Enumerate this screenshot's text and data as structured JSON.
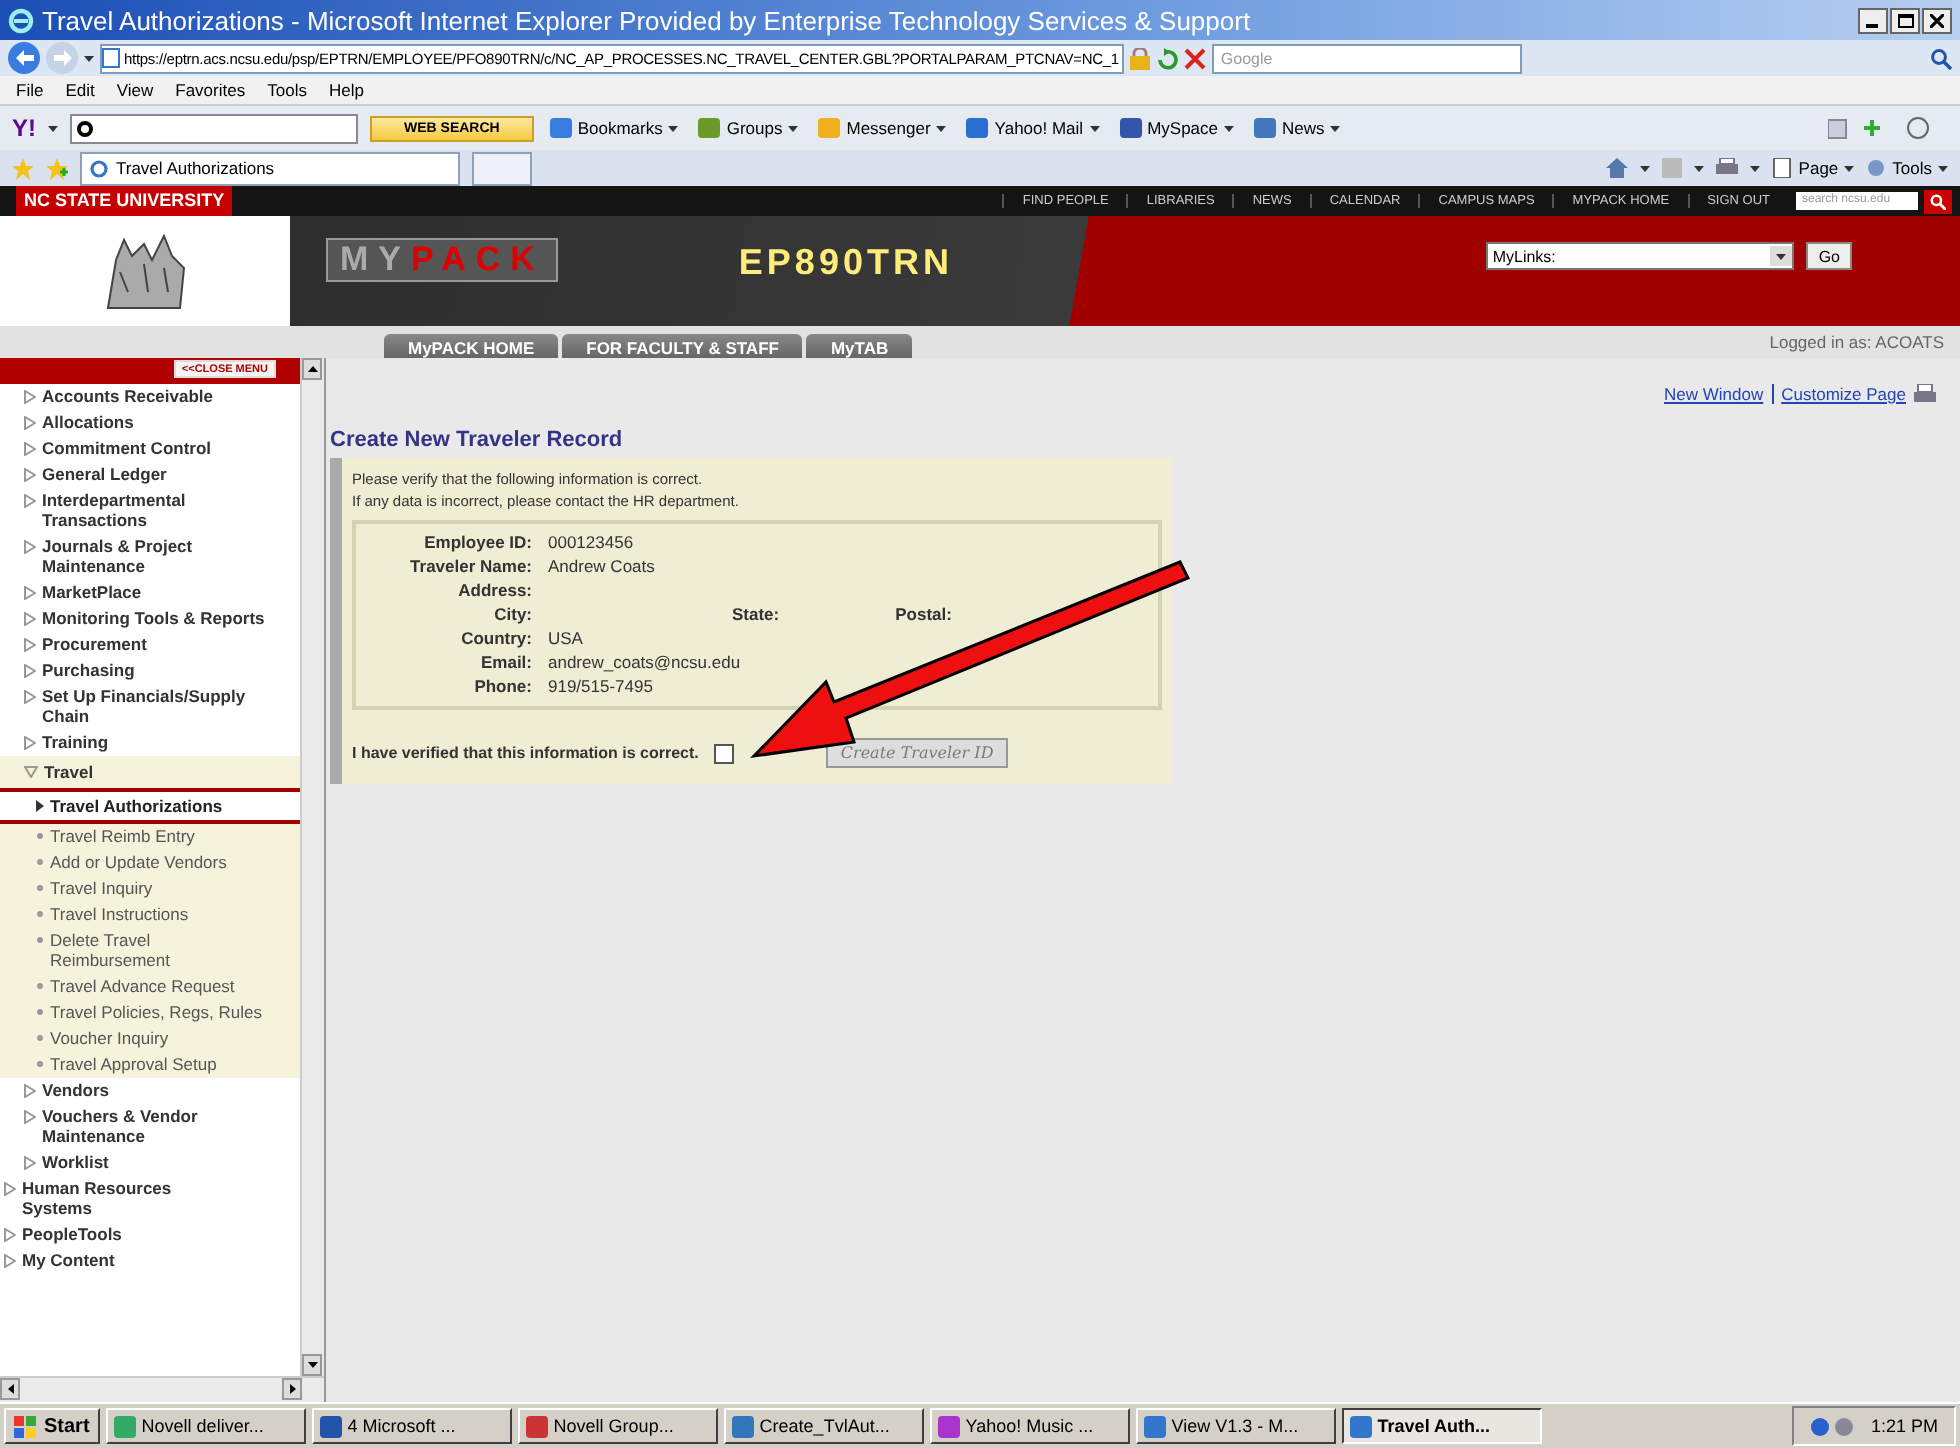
{
  "window": {
    "title": "Travel Authorizations - Microsoft Internet Explorer Provided by Enterprise Technology Services & Support"
  },
  "address_bar": {
    "url": "https://eptrn.acs.ncsu.edu/psp/EPTRN/EMPLOYEE/PFO890TRN/c/NC_AP_PROCESSES.NC_TRAVEL_CENTER.GBL?PORTALPARAM_PTCNAV=NC_1",
    "search_placeholder": "Google"
  },
  "menu_bar": [
    "File",
    "Edit",
    "View",
    "Favorites",
    "Tools",
    "Help"
  ],
  "yahoo_toolbar": {
    "logo": "Y!",
    "search_button": "WEB SEARCH",
    "items": [
      "Bookmarks",
      "Groups",
      "Messenger",
      "Yahoo! Mail",
      "MySpace",
      "News"
    ]
  },
  "tab_bar": {
    "tabs": [
      {
        "label": "Travel Authorizations",
        "selected": true
      }
    ],
    "commands": [
      "Page",
      "Tools"
    ]
  },
  "site_header": {
    "university": "NC STATE UNIVERSITY",
    "links": [
      "FIND PEOPLE",
      "LIBRARIES",
      "NEWS",
      "CALENDAR",
      "CAMPUS MAPS",
      "MYPACK HOME",
      "SIGN OUT"
    ],
    "search_placeholder": "search ncsu.edu",
    "logo": [
      "MY",
      "PACK"
    ],
    "system": "EP890TRN",
    "mylinks": "MyLinks:",
    "go": "Go"
  },
  "nav_tabs": [
    "MyPACK HOME",
    "FOR FACULTY & STAFF",
    "MyTAB"
  ],
  "logged_in": "Logged in as: ACOATS",
  "page_links": [
    "New Window",
    "Customize Page"
  ],
  "sidebar": {
    "close_button": "<<CLOSE MENU",
    "items": [
      {
        "label": "Accounts Receivable",
        "kind": "folder",
        "expanded": false
      },
      {
        "label": "Allocations",
        "kind": "folder",
        "expanded": false
      },
      {
        "label": "Commitment Control",
        "kind": "folder",
        "expanded": false
      },
      {
        "label": "General Ledger",
        "kind": "folder",
        "expanded": false
      },
      {
        "label": "Interdepartmental Transactions",
        "kind": "folder",
        "expanded": false
      },
      {
        "label": "Journals & Project Maintenance",
        "kind": "folder",
        "expanded": false
      },
      {
        "label": "MarketPlace",
        "kind": "folder",
        "expanded": false
      },
      {
        "label": "Monitoring Tools & Reports",
        "kind": "folder",
        "expanded": false
      },
      {
        "label": "Procurement",
        "kind": "folder",
        "expanded": false
      },
      {
        "label": "Purchasing",
        "kind": "folder",
        "expanded": false
      },
      {
        "label": "Set Up Financials/Supply Chain",
        "kind": "folder",
        "expanded": false
      },
      {
        "label": "Training",
        "kind": "folder",
        "expanded": false
      },
      {
        "label": "Travel",
        "kind": "folder",
        "expanded": true,
        "children": [
          {
            "label": "Travel Authorizations",
            "kind": "page",
            "selected": true
          },
          {
            "label": "Travel Reimb Entry",
            "kind": "page",
            "selected": false
          },
          {
            "label": "Add or Update Vendors",
            "kind": "page",
            "selected": false
          },
          {
            "label": "Travel Inquiry",
            "kind": "page",
            "selected": false
          },
          {
            "label": "Travel Instructions",
            "kind": "page",
            "selected": false
          },
          {
            "label": "Delete Travel Reimbursement",
            "kind": "page",
            "selected": false
          },
          {
            "label": "Travel Advance Request",
            "kind": "page",
            "selected": false
          },
          {
            "label": "Travel Policies, Regs, Rules",
            "kind": "page",
            "selected": false
          },
          {
            "label": "Voucher Inquiry",
            "kind": "page",
            "selected": false
          },
          {
            "label": "Travel Approval Setup",
            "kind": "page",
            "selected": false
          }
        ]
      },
      {
        "label": "Vendors",
        "kind": "folder",
        "expanded": false
      },
      {
        "label": "Vouchers & Vendor Maintenance",
        "kind": "folder",
        "expanded": false
      },
      {
        "label": "Worklist",
        "kind": "folder",
        "expanded": false
      }
    ],
    "outer_items": [
      {
        "label": "Human Resources Systems",
        "kind": "folder",
        "expanded": false
      },
      {
        "label": "PeopleTools",
        "kind": "folder",
        "expanded": false
      },
      {
        "label": "My Content",
        "kind": "folder",
        "expanded": false
      }
    ]
  },
  "form": {
    "title": "Create New Traveler Record",
    "instructions": [
      "Please verify that the following information is correct.",
      "If any data is incorrect, please contact the HR department."
    ],
    "rows": [
      {
        "fields": [
          {
            "label": "Employee ID:",
            "value": "000123456"
          }
        ]
      },
      {
        "fields": [
          {
            "label": "Traveler Name:",
            "value": "Andrew  Coats"
          }
        ]
      },
      {
        "fields": [
          {
            "label": "Address:"
          }
        ]
      },
      {
        "fields": [
          {
            "label": "City:"
          },
          {
            "label": "State:"
          },
          {
            "label": "Postal:"
          }
        ]
      },
      {
        "fields": [
          {
            "label": "Country:",
            "value": "USA"
          }
        ]
      },
      {
        "fields": [
          {
            "label": "Email:",
            "value": "andrew_coats@ncsu.edu"
          }
        ]
      },
      {
        "fields": [
          {
            "label": "Phone:",
            "value": "919/515-7495"
          }
        ]
      }
    ],
    "verify": {
      "label": "I have verified that this information is correct.",
      "checked": false
    },
    "submit": {
      "label": "Create Traveler ID",
      "disabled": true
    }
  },
  "taskbar": {
    "start": "Start",
    "items": [
      {
        "label": "Novell deliver...",
        "selected": false
      },
      {
        "label": "4 Microsoft ...",
        "selected": false
      },
      {
        "label": "Novell Group...",
        "selected": false
      },
      {
        "label": "Create_TvlAut...",
        "selected": false
      },
      {
        "label": "Yahoo! Music ...",
        "selected": false
      },
      {
        "label": "View V1.3 - M...",
        "selected": false
      },
      {
        "label": "Travel Auth...",
        "selected": true
      }
    ],
    "clock": "1:21 PM"
  }
}
